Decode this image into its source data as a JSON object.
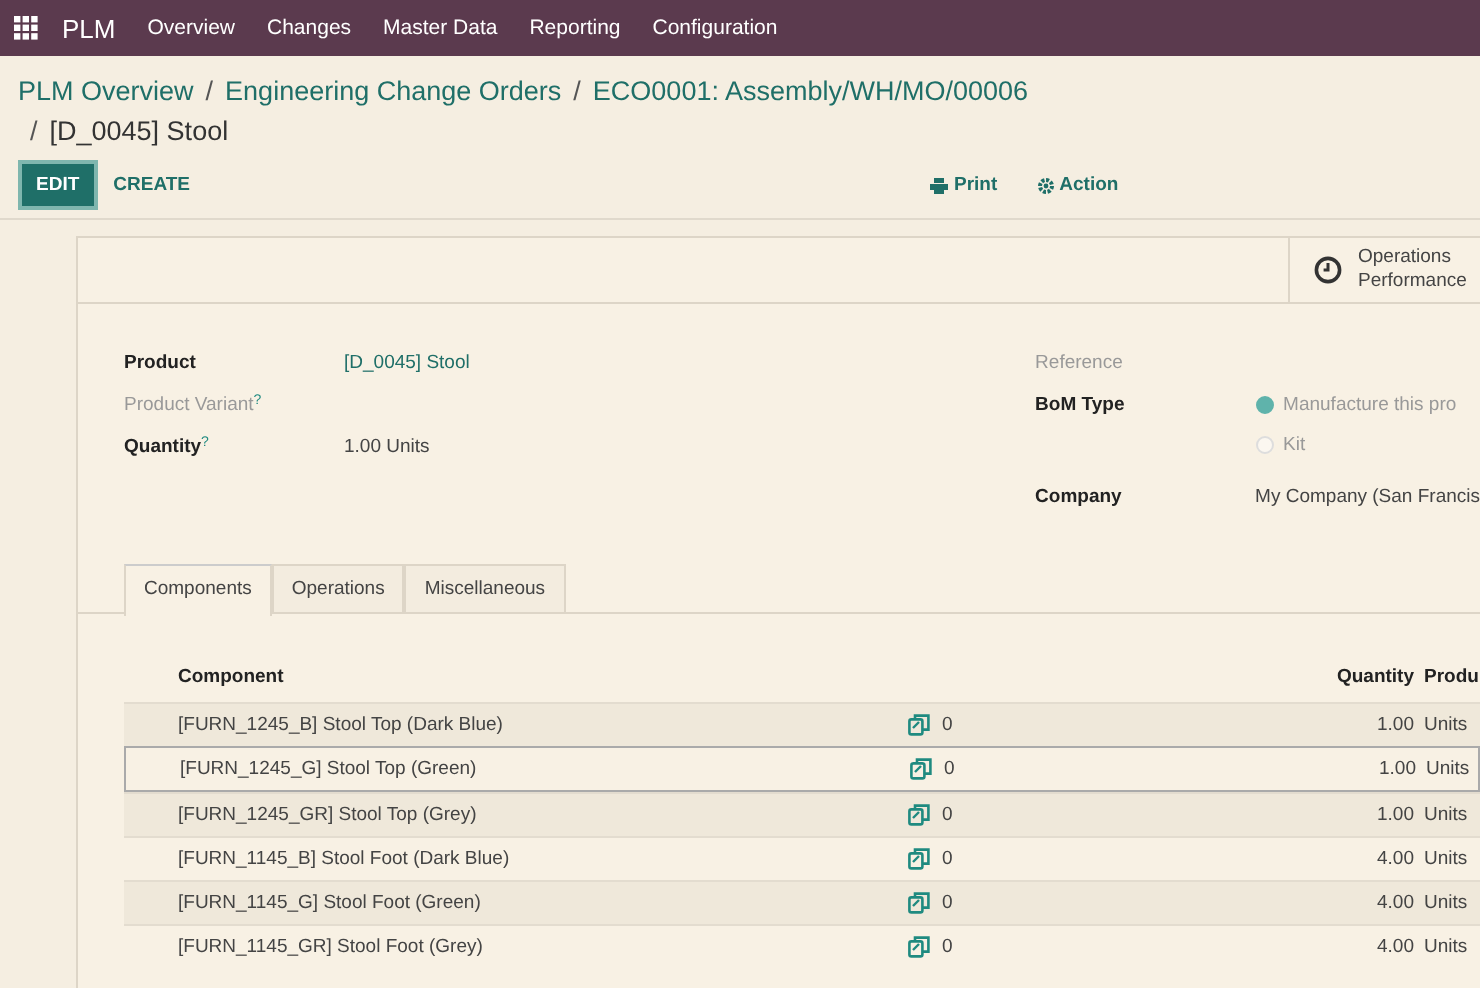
{
  "app_name": "PLM",
  "menu": [
    "Overview",
    "Changes",
    "Master Data",
    "Reporting",
    "Configuration"
  ],
  "breadcrumb_separator": "/",
  "breadcrumbs": [
    {
      "label": "PLM Overview",
      "kind": "link"
    },
    {
      "label": "Engineering Change Orders",
      "kind": "link"
    },
    {
      "label": "ECO0001: Assembly/WH/MO/00006",
      "kind": "link"
    },
    {
      "label": "[D_0045] Stool",
      "kind": "current"
    }
  ],
  "buttons": {
    "edit": "EDIT",
    "create": "CREATE",
    "print": "Print",
    "action": "Action"
  },
  "smart_button": {
    "line_1": "Operations",
    "line_2": "Performance"
  },
  "left_fields": [
    {
      "label": "Product",
      "value": "[D_0045] Stool",
      "kind": "link"
    },
    {
      "label": "Product Variant",
      "help": "?",
      "kind": "optional"
    },
    {
      "label": "Quantity",
      "value": "1.00 Units",
      "help": "?",
      "kind": "plain"
    }
  ],
  "reference_label": "Reference",
  "bom_type": {
    "label": "BoM Type",
    "options": [
      {
        "label": "Manufacture this pro",
        "selected": true
      },
      {
        "label": "Kit",
        "selected": false
      }
    ]
  },
  "company": {
    "label": "Company",
    "value": "My Company (San Francis"
  },
  "tabs": [
    {
      "label": "Components",
      "selected": true
    },
    {
      "label": "Operations",
      "selected": false
    },
    {
      "label": "Miscellaneous",
      "selected": false
    }
  ],
  "table": {
    "columns": [
      "Component",
      "Quantity",
      "Produ"
    ],
    "rows": [
      {
        "component": "[FURN_1245_B] Stool Top (Dark Blue)",
        "count": "0",
        "quantity": "1.00",
        "uom": "Units",
        "hovered": false
      },
      {
        "component": "[FURN_1245_G] Stool Top (Green)",
        "count": "0",
        "quantity": "1.00",
        "uom": "Units",
        "hovered": true
      },
      {
        "component": "[FURN_1245_GR] Stool Top (Grey)",
        "count": "0",
        "quantity": "1.00",
        "uom": "Units",
        "hovered": false
      },
      {
        "component": "[FURN_1145_B] Stool Foot (Dark Blue)",
        "count": "0",
        "quantity": "4.00",
        "uom": "Units",
        "hovered": false
      },
      {
        "component": "[FURN_1145_G] Stool Foot (Green)",
        "count": "0",
        "quantity": "4.00",
        "uom": "Units",
        "hovered": false
      },
      {
        "component": "[FURN_1145_GR] Stool Foot (Grey)",
        "count": "0",
        "quantity": "4.00",
        "uom": "Units",
        "hovered": false
      }
    ]
  }
}
